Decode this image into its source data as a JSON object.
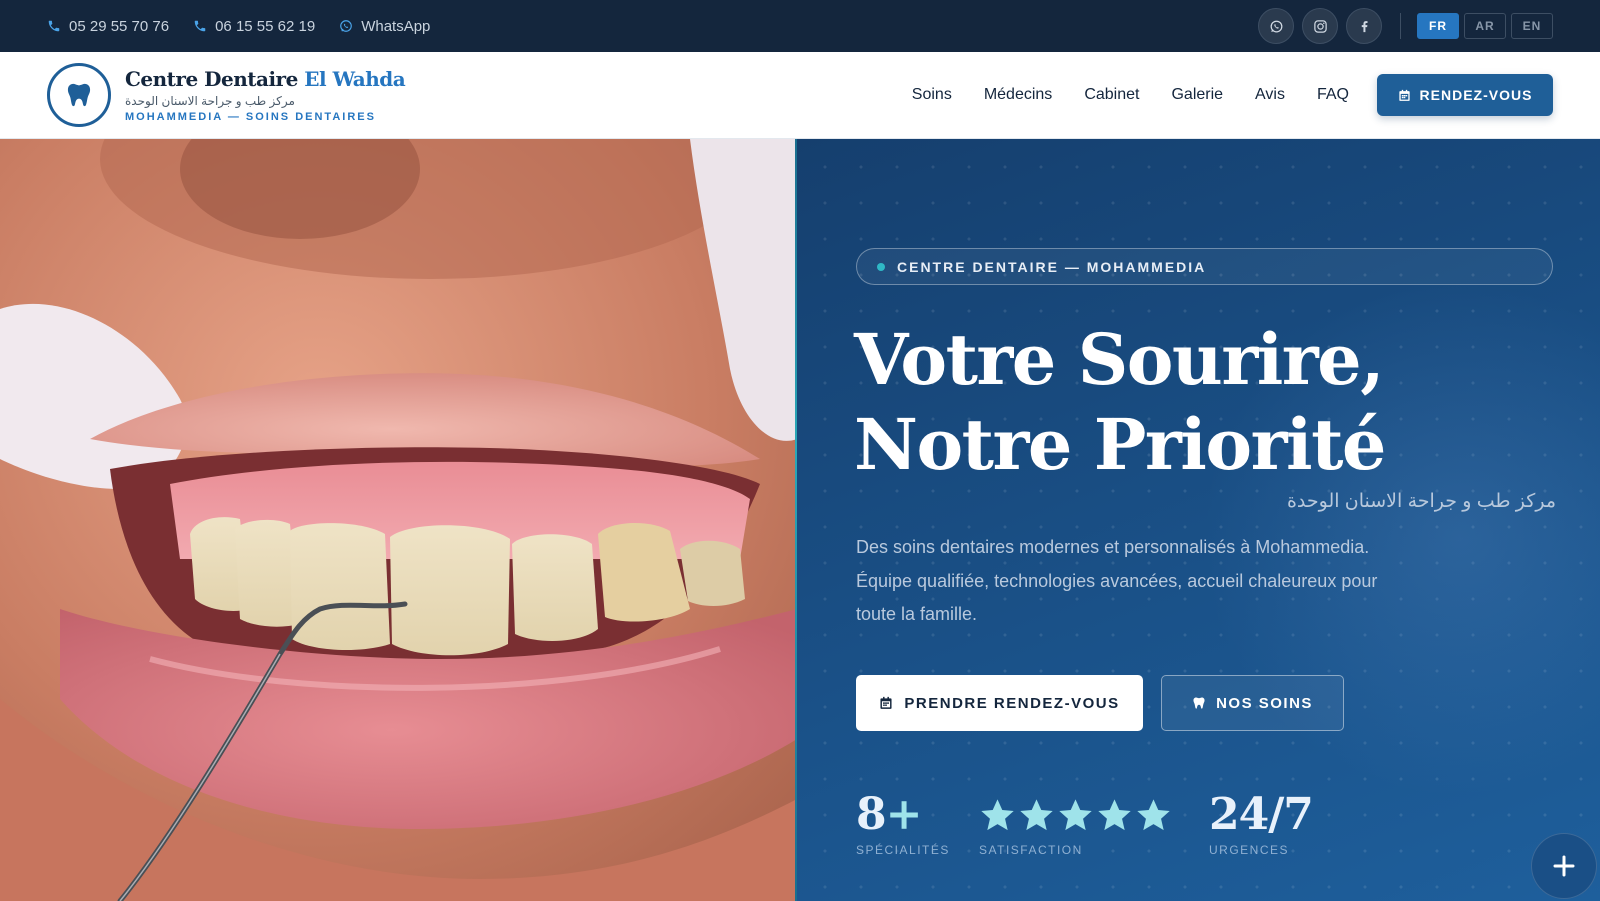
{
  "topbar": {
    "phone1": "05 29 55 70 76",
    "phone2": "06 15 55 62 19",
    "whatsapp": "WhatsApp",
    "social_icons": [
      "whatsapp-icon",
      "instagram-icon",
      "facebook-icon"
    ],
    "languages": [
      {
        "code": "FR",
        "active": true
      },
      {
        "code": "AR",
        "active": false
      },
      {
        "code": "EN",
        "active": false
      }
    ]
  },
  "brand": {
    "name": "Centre Dentaire",
    "name_accent": "El Wahda",
    "arabic": "مركز طب و جراحة الاسنان الوحدة",
    "subtitle": "MOHAMMEDIA — SOINS DENTAIRES"
  },
  "nav": {
    "links": [
      "Soins",
      "Médecins",
      "Cabinet",
      "Galerie",
      "Avis",
      "FAQ"
    ],
    "cta": "RENDEZ-VOUS"
  },
  "hero": {
    "badge": "CENTRE DENTAIRE — MOHAMMEDIA",
    "title_line1": "Votre Sourire,",
    "title_line2": "Notre Priorité",
    "arabic": "مركز طب و جراحة الاسنان الوحدة",
    "description": "Des soins dentaires modernes et personnalisés à Mohammedia. Équipe qualifiée, technologies avancées, accueil chaleureux pour toute la famille.",
    "btn_primary": "PRENDRE RENDEZ-VOUS",
    "btn_secondary": "NOS SOINS"
  },
  "stats": [
    {
      "value": "8",
      "suffix": "+",
      "label": "SPÉCIALITÉS"
    },
    {
      "stars": 5,
      "label": "SATISFACTION"
    },
    {
      "value": "24/7",
      "label": "URGENCES"
    }
  ],
  "colors": {
    "topbar": "#14263d",
    "brand_blue": "#2676c0",
    "hero_blue": "#1a5188",
    "teal": "#2fb8c6",
    "star": "#9fe3ea"
  }
}
